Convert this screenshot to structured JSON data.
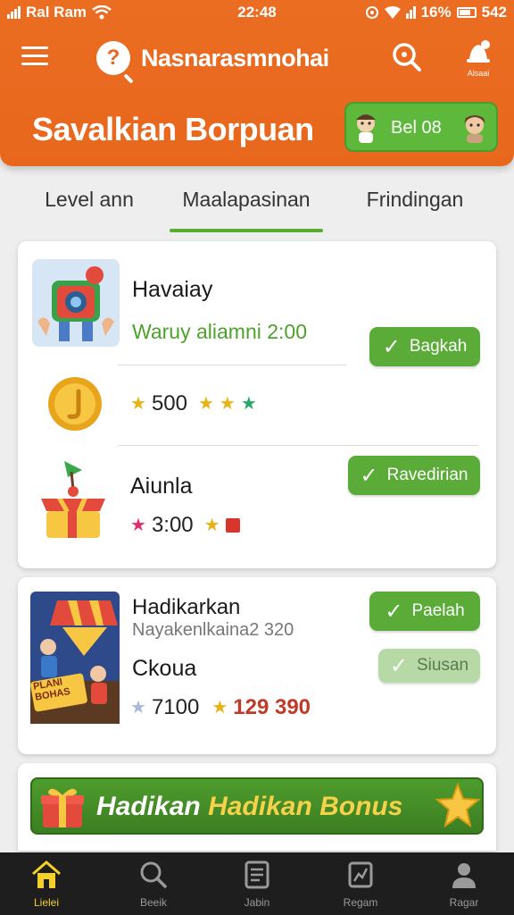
{
  "status_bar": {
    "carrier": "Ral Ram",
    "time": "22:48",
    "battery_pct": "16%",
    "extra": "542"
  },
  "header": {
    "app_name": "Nasnarasmnohai",
    "promo_title": "Savalkian Borpuan",
    "chip_label": "Bel 08",
    "bell_caption": "Alsaai"
  },
  "tabs": [
    {
      "label": "Level ann"
    },
    {
      "label": "Maalapasinan",
      "active": true
    },
    {
      "label": "Frindingan"
    }
  ],
  "card1": {
    "item1": {
      "name": "Havaiay",
      "subtitle": "Waruy aliamni 2:00",
      "button": "Bagkah",
      "reward_value": "500"
    },
    "item2": {
      "name": "Aiunla",
      "button": "Ravedirian",
      "reward_value": "3:00"
    }
  },
  "card2": {
    "title": "Hadikarkan",
    "subtitle": "Nayakenlkaina2 320",
    "name": "Ckoua",
    "button_primary": "Paelah",
    "button_secondary": "Siusan",
    "reward_value": "7100",
    "reward_value_highlight": "129 390",
    "art_text": "PLANI BOHAS"
  },
  "bonus_banner": {
    "word1": "Hadikan",
    "word2": "Hadikan Bonus"
  },
  "bottom_nav": [
    {
      "label": "Lielei",
      "icon": "home-icon",
      "active": true
    },
    {
      "label": "Beeik",
      "icon": "search-icon"
    },
    {
      "label": "Jabin",
      "icon": "list-icon"
    },
    {
      "label": "Regam",
      "icon": "chart-icon"
    },
    {
      "label": "Ragar",
      "icon": "user-icon"
    }
  ],
  "colors": {
    "header": "#e8671d",
    "accent_green": "#5aab37",
    "nav_active": "#f3d129"
  }
}
